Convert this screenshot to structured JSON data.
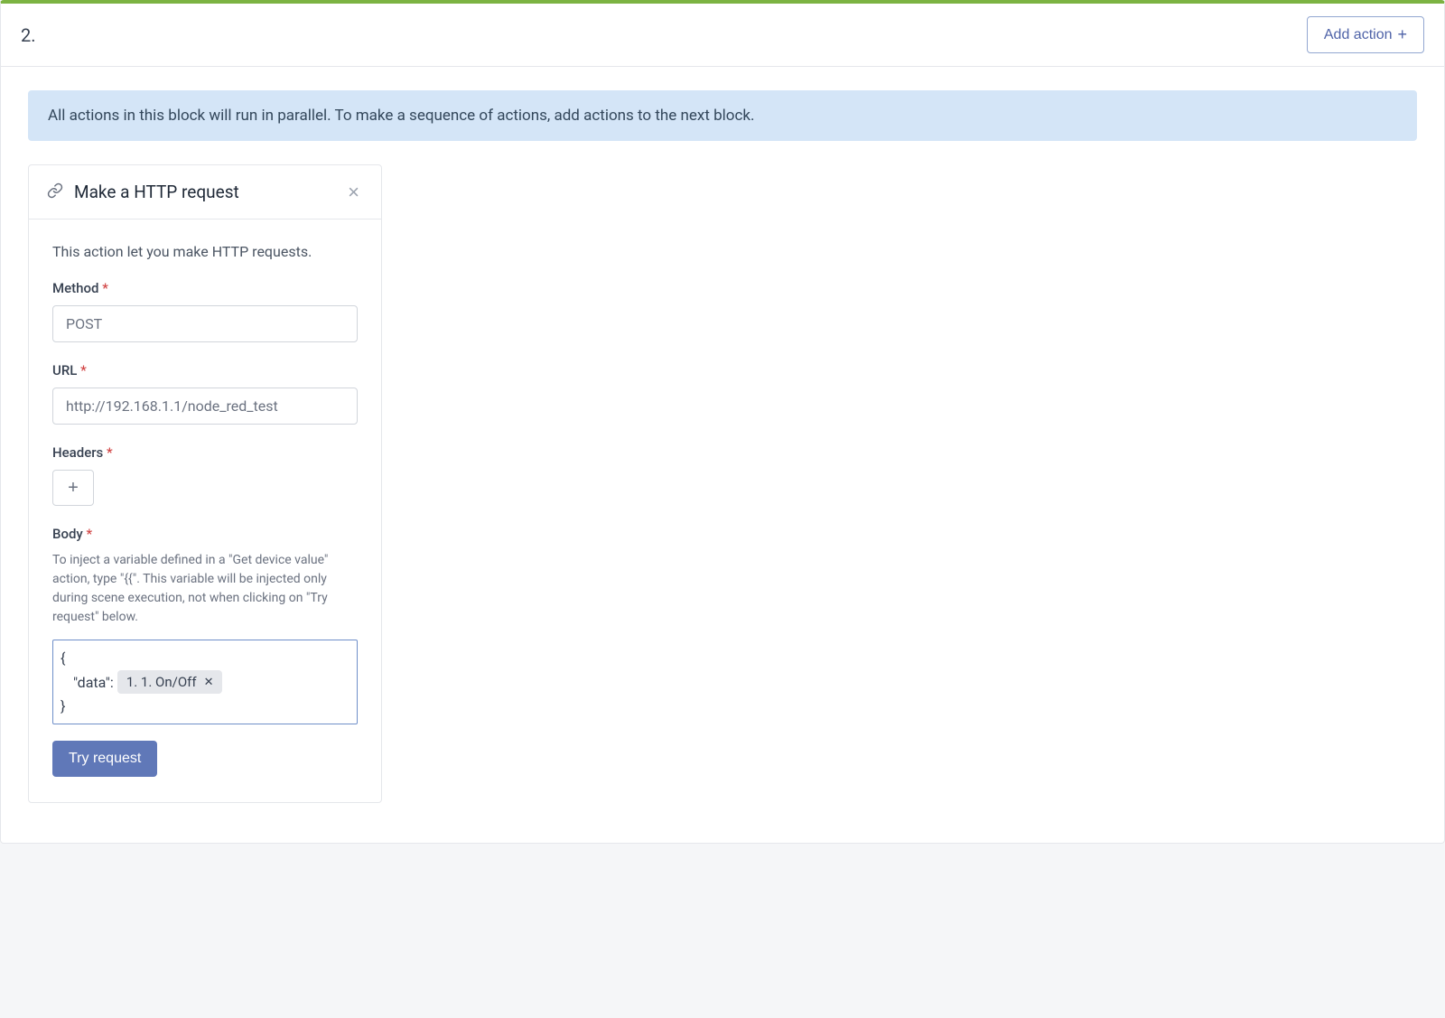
{
  "block": {
    "number": "2.",
    "add_action_label": "Add action",
    "info_text": "All actions in this block will run in parallel. To make a sequence of actions, add actions to the next block."
  },
  "action": {
    "title": "Make a HTTP request",
    "description": "This action let you make HTTP requests.",
    "method_label": "Method",
    "method_value": "POST",
    "url_label": "URL",
    "url_value": "http://192.168.1.1/node_red_test",
    "headers_label": "Headers",
    "body_label": "Body",
    "body_help": "To inject a variable defined in a \"Get device value\" action, type \"{{\". This variable will be injected only during scene execution, not when clicking on \"Try request\" below.",
    "body_line1": "{",
    "body_line2_key": "\"data\":",
    "body_chip": "1. 1. On/Off",
    "body_line3": "}",
    "try_label": "Try request"
  }
}
